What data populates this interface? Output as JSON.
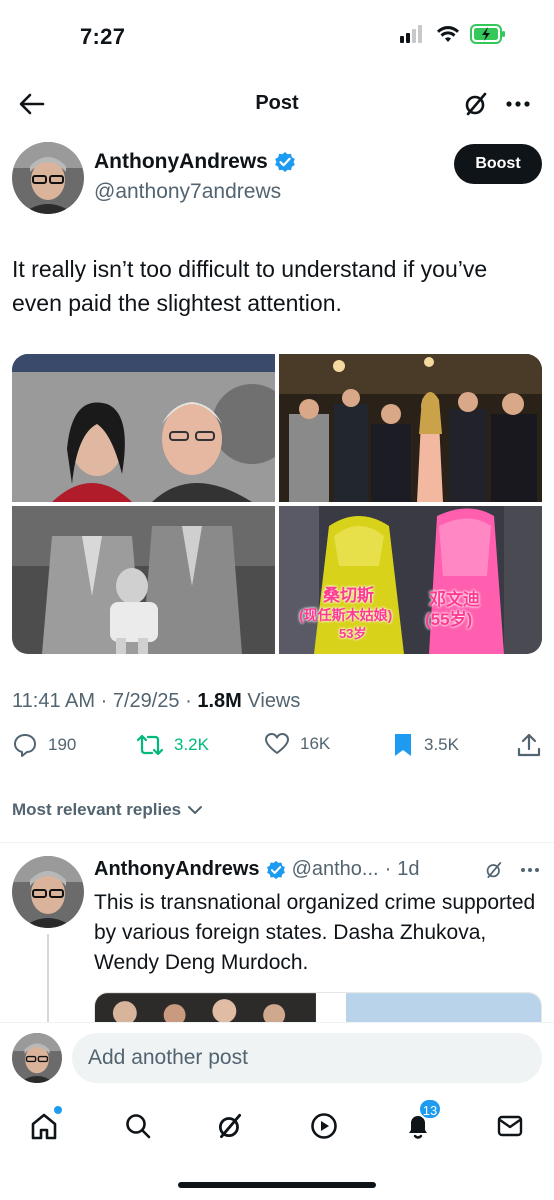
{
  "status_bar": {
    "time": "7:27"
  },
  "header": {
    "title": "Post",
    "back_icon": "back-arrow-icon",
    "grok_icon": "grok-icon",
    "more_icon": "more-icon"
  },
  "post": {
    "author_name": "AnthonyAndrews",
    "author_handle": "@anthony7andrews",
    "boost_label": "Boost",
    "text": "It really isn’t too difficult to understand if you’ve even paid the slightest attention.",
    "media_captions": {
      "left_name": "桑切斯",
      "left_note": "(现任斯木姑娘)",
      "left_age": "53岁",
      "right_name": "邓文迪",
      "right_age": "(55岁)"
    },
    "time": "11:41 AM",
    "date": "7/29/25",
    "views_count": "1.8M",
    "views_label": "Views",
    "stats": {
      "replies": "190",
      "reposts": "3.2K",
      "likes": "16K",
      "bookmarks": "3.5K"
    },
    "reply_sort_label": "Most relevant replies"
  },
  "reply": {
    "author_name": "AnthonyAndrews",
    "author_handle": "@antho...",
    "age": "1d",
    "text": "This is transnational organized crime supported by various foreign states. Dasha Zhukova, Wendy Deng Murdoch."
  },
  "composer": {
    "placeholder": "Add another post"
  },
  "bottom_nav": {
    "notifications_badge": "13"
  },
  "colors": {
    "accent": "#1d9bf0",
    "repost": "#00ba7c",
    "text": "#0f1419",
    "muted": "#536471"
  }
}
